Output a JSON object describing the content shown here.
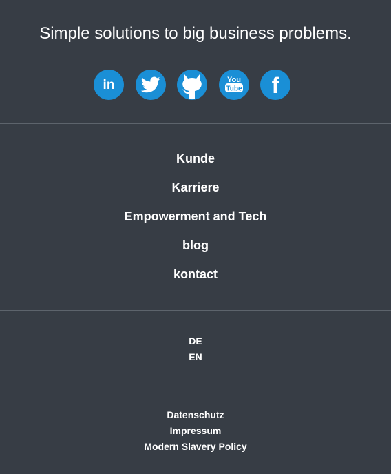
{
  "footer": {
    "tagline": "Simple solutions to big business problems.",
    "social": [
      {
        "name": "linkedin",
        "icon": "linkedin-icon",
        "glyph": "in"
      },
      {
        "name": "twitter",
        "icon": "twitter-icon"
      },
      {
        "name": "github",
        "icon": "github-icon"
      },
      {
        "name": "youtube",
        "icon": "youtube-icon",
        "glyph_top": "You",
        "glyph_bottom": "Tube"
      },
      {
        "name": "facebook",
        "icon": "facebook-icon",
        "glyph": "f"
      }
    ],
    "nav": [
      {
        "label": "Kunde"
      },
      {
        "label": "Karriere"
      },
      {
        "label": "Empowerment and Tech"
      },
      {
        "label": "blog"
      },
      {
        "label": "kontact"
      }
    ],
    "languages": [
      {
        "label": "DE"
      },
      {
        "label": "EN"
      }
    ],
    "legal": [
      {
        "label": "Datenschutz"
      },
      {
        "label": "Impressum"
      },
      {
        "label": "Modern Slavery Policy"
      }
    ]
  },
  "colors": {
    "background": "#373d45",
    "divider": "#5d646c",
    "social_bg": "#1a8fd6",
    "text": "#ffffff"
  }
}
